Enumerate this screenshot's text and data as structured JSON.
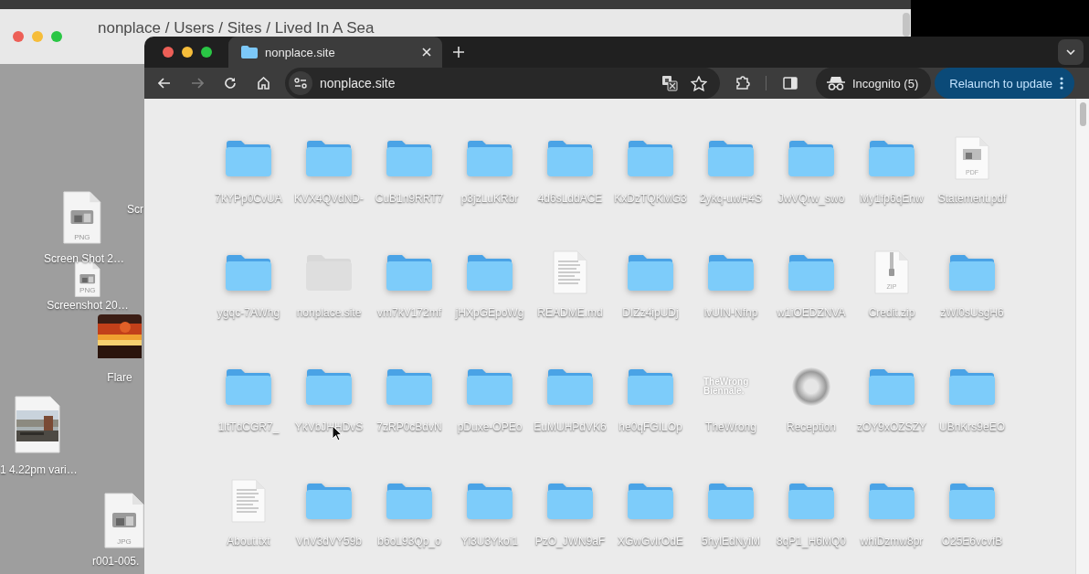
{
  "finder": {
    "title": "nonplace / Users / Sites / Lived In A Sea"
  },
  "desktop_items": [
    {
      "label": "Scr",
      "kind": "label-only"
    },
    {
      "label": "Screen Shot 2…",
      "kind": "image-file",
      "badge": "PNG"
    },
    {
      "label": "Screenshot 20…",
      "kind": "image-file",
      "badge": "PNG"
    },
    {
      "label": "Flare"
    },
    {
      "label": "1 4.22pm vari…",
      "kind": "photo-file"
    },
    {
      "label": "r001-005.",
      "kind": "image-file",
      "badge": "JPG"
    }
  ],
  "browser": {
    "tab": {
      "title": "nonplace.site",
      "selected": true
    },
    "url": "nonplace.site",
    "back_enabled": true,
    "forward_enabled": false,
    "incognito": "Incognito (5)",
    "update_button": "Relaunch to update"
  },
  "files": [
    {
      "label": "7kYPp0CvUA",
      "kind": "folder",
      "dimmed": false
    },
    {
      "label": "KVX4QVdND-",
      "kind": "folder",
      "dimmed": false
    },
    {
      "label": "CuB1n9RRT7",
      "kind": "folder",
      "dimmed": false
    },
    {
      "label": "p3jzLuKRbr",
      "kind": "folder",
      "dimmed": false
    },
    {
      "label": "4d6sLddACE",
      "kind": "folder",
      "dimmed": false
    },
    {
      "label": "KxDzTQKMG3",
      "kind": "folder",
      "dimmed": false
    },
    {
      "label": "2ykq-uwH4S",
      "kind": "folder",
      "dimmed": false
    },
    {
      "label": "JwVQrw_swo",
      "kind": "folder",
      "dimmed": false
    },
    {
      "label": "My1fp6qEnw",
      "kind": "folder",
      "dimmed": false
    },
    {
      "label": "Statement.pdf",
      "kind": "document",
      "badge": "PDF"
    },
    {
      "label": "ygqc-7AWhg",
      "kind": "folder",
      "dimmed": false
    },
    {
      "label": "nonplace.site",
      "kind": "folder",
      "dimmed": true
    },
    {
      "label": "vm7kV172mf",
      "kind": "folder",
      "dimmed": false
    },
    {
      "label": "jHXpGEpoWg",
      "kind": "folder",
      "dimmed": false
    },
    {
      "label": "README.md",
      "kind": "document"
    },
    {
      "label": "DIZz4ipUDj",
      "kind": "folder",
      "dimmed": false
    },
    {
      "label": "lvUIN-Nfnp",
      "kind": "folder",
      "dimmed": false
    },
    {
      "label": "w1iOEDZNVA",
      "kind": "folder",
      "dimmed": false
    },
    {
      "label": "Credit.zip",
      "kind": "archive",
      "badge": "ZIP"
    },
    {
      "label": "zWl0sUsgH6",
      "kind": "folder",
      "dimmed": false
    },
    {
      "label": "1ltTdCGR7_",
      "kind": "folder",
      "dimmed": false
    },
    {
      "label": "YkVbJHHDvS",
      "kind": "folder",
      "dimmed": false
    },
    {
      "label": "7zRP0cBdvN",
      "kind": "folder",
      "dimmed": false
    },
    {
      "label": "pDuxe-OPEo",
      "kind": "folder",
      "dimmed": false
    },
    {
      "label": "EuMUHPdVK6",
      "kind": "folder",
      "dimmed": false
    },
    {
      "label": "he0qFGILOp",
      "kind": "folder",
      "dimmed": false
    },
    {
      "label": "TheWrong",
      "kind": "logo",
      "logo_text": "TheWrong Biennale."
    },
    {
      "label": "Reception",
      "kind": "blur"
    },
    {
      "label": "zOY9xOZSZY",
      "kind": "folder",
      "dimmed": false
    },
    {
      "label": "UBnKrs9eEO",
      "kind": "folder",
      "dimmed": false
    },
    {
      "label": "About.txt",
      "kind": "document"
    },
    {
      "label": "VnV3dVY59b",
      "kind": "folder",
      "dimmed": false
    },
    {
      "label": "b6oL93Qp_o",
      "kind": "folder",
      "dimmed": false
    },
    {
      "label": "Yi3U3Ykoi1",
      "kind": "folder",
      "dimmed": false
    },
    {
      "label": "PzO_JWN9aF",
      "kind": "folder",
      "dimmed": false
    },
    {
      "label": "XGwGvlrOdE",
      "kind": "folder",
      "dimmed": false
    },
    {
      "label": "5hylEdNyiM",
      "kind": "folder",
      "dimmed": false
    },
    {
      "label": "8qP1_H6MQ0",
      "kind": "folder",
      "dimmed": false
    },
    {
      "label": "whiDzmw8pr",
      "kind": "folder",
      "dimmed": false
    },
    {
      "label": "O25E6vcvfB",
      "kind": "folder",
      "dimmed": false
    }
  ]
}
